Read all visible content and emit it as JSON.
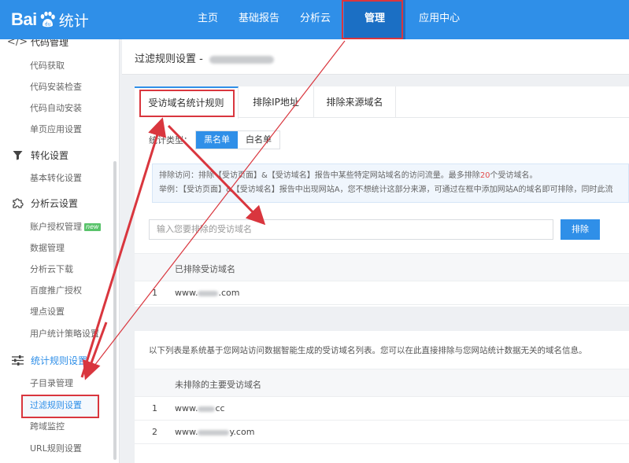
{
  "header": {
    "logo_text": "Bai",
    "logo_suffix": "统计",
    "nav": [
      {
        "label": "主页"
      },
      {
        "label": "基础报告"
      },
      {
        "label": "分析云"
      },
      {
        "label": "管理",
        "active": true
      },
      {
        "label": "应用中心"
      }
    ]
  },
  "sidebar": {
    "groups": [
      {
        "label": "代码管理",
        "icon": "code-icon",
        "items": [
          "代码获取",
          "代码安装检查",
          "代码自动安装",
          "单页应用设置"
        ]
      },
      {
        "label": "转化设置",
        "icon": "funnel-icon",
        "items": [
          "基本转化设置"
        ]
      },
      {
        "label": "分析云设置",
        "icon": "puzzle-icon",
        "items": [
          "账户授权管理",
          "数据管理",
          "分析云下载",
          "百度推广授权",
          "埋点设置",
          "用户统计策略设置"
        ]
      },
      {
        "label": "统计规则设置",
        "icon": "sliders-icon",
        "items": [
          "子目录管理",
          "过滤规则设置",
          "跨域监控",
          "URL规则设置"
        ]
      }
    ],
    "new_badge": "new",
    "active_item": "过滤规则设置"
  },
  "main": {
    "title": "过滤规则设置 -",
    "tabs": [
      {
        "label": "受访域名统计规则",
        "active": true
      },
      {
        "label": "排除IP地址"
      },
      {
        "label": "排除来源域名"
      }
    ],
    "type_label": "统计类型：",
    "type_options": [
      {
        "label": "黑名单",
        "selected": true
      },
      {
        "label": "白名单"
      }
    ],
    "info_line1_a": "排除访问：排除【受访页面】&【受访域名】报告中某些特定网站域名的访问流量。最多排除",
    "info_line1_num": "20",
    "info_line1_b": "个受访域名。",
    "info_line2": "举例：【受访页面】&【受访域名】报告中出现网站A，您不想统计这部分来源，可通过在框中添加网站A的域名即可排除，同时此流",
    "input_placeholder": "输入您要排除的受访域名",
    "exclude_button": "排除",
    "excluded_table": {
      "header": "已排除受访域名",
      "rows": [
        {
          "index": "1",
          "prefix": "www.",
          "suffix": ".com"
        }
      ]
    },
    "suggest_desc": "以下列表是系统基于您网站访问数据智能生成的受访域名列表。您可以在此直接排除与您网站统计数据无关的域名信息。",
    "unexcluded_table": {
      "header": "未排除的主要受访域名",
      "rows": [
        {
          "index": "1",
          "prefix": "www.",
          "suffix": "cc"
        },
        {
          "index": "2",
          "prefix": "www.",
          "suffix": "y.com"
        }
      ]
    }
  },
  "colors": {
    "brand": "#2f8fe8",
    "nav_active": "#1b6fc4",
    "annotation": "#d9363e"
  }
}
